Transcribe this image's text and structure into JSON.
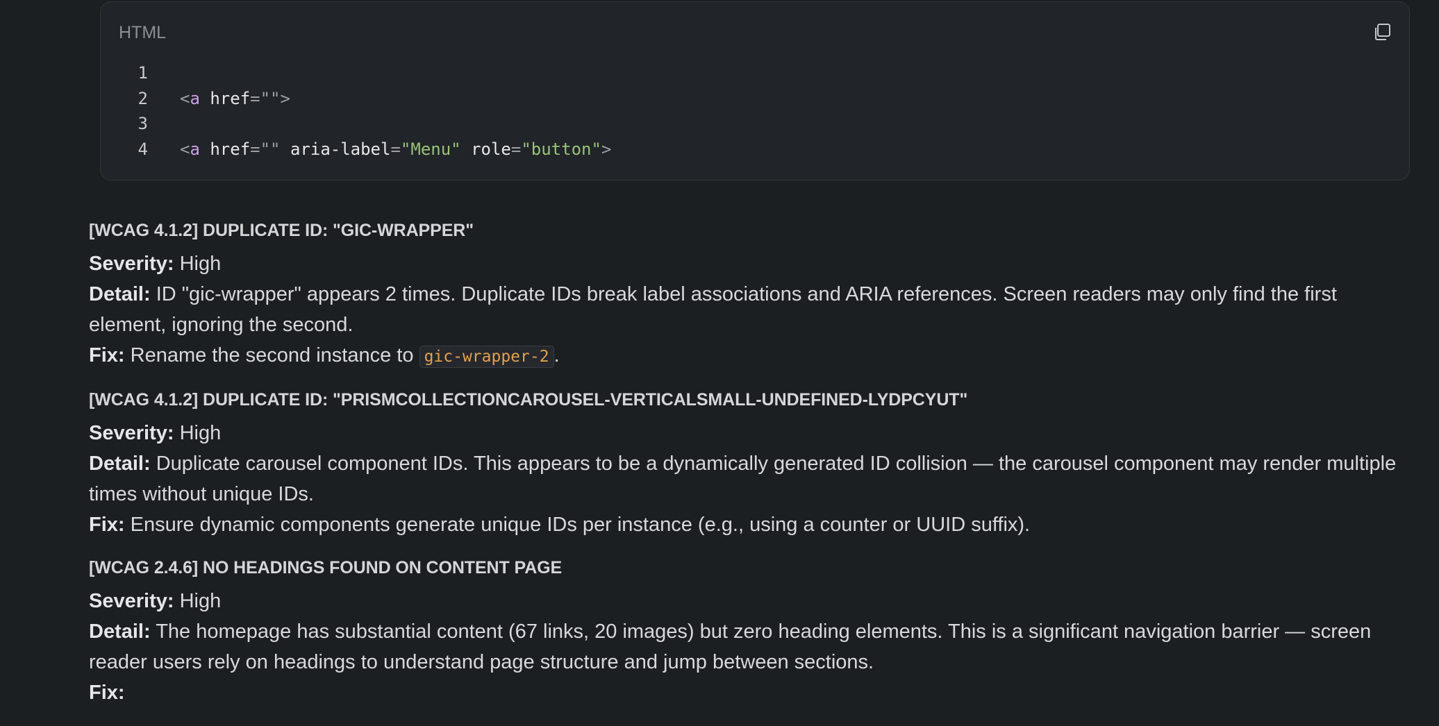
{
  "code_block": {
    "language": "HTML",
    "copy_icon": "copy-icon",
    "lines": [
      {
        "num": "1",
        "parts": []
      },
      {
        "num": "2",
        "parts": [
          {
            "t": "<",
            "k": "punc"
          },
          {
            "t": "a",
            "k": "tag"
          },
          {
            "t": " href",
            "k": "attr"
          },
          {
            "t": "=\"\"",
            "k": "punc"
          },
          {
            "t": ">",
            "k": "punc"
          }
        ]
      },
      {
        "num": "3",
        "parts": []
      },
      {
        "num": "4",
        "parts": [
          {
            "t": "<",
            "k": "punc"
          },
          {
            "t": "a",
            "k": "tag"
          },
          {
            "t": " href",
            "k": "attr"
          },
          {
            "t": "=\"\"",
            "k": "punc"
          },
          {
            "t": " aria-label",
            "k": "attr"
          },
          {
            "t": "=",
            "k": "punc"
          },
          {
            "t": "\"Menu\"",
            "k": "str"
          },
          {
            "t": " role",
            "k": "attr"
          },
          {
            "t": "=",
            "k": "punc"
          },
          {
            "t": "\"button\"",
            "k": "str"
          },
          {
            "t": ">",
            "k": "punc"
          }
        ]
      }
    ]
  },
  "issues": [
    {
      "title": "[WCAG 4.1.2] DUPLICATE ID: \"GIC-WRAPPER\"",
      "severity_label": "Severity:",
      "severity": "High",
      "detail_label": "Detail:",
      "detail": "ID \"gic-wrapper\" appears 2 times. Duplicate IDs break label associations and ARIA references. Screen readers may only find the first element, ignoring the second.",
      "fix_label": "Fix:",
      "fix_before": "Rename the second instance to ",
      "fix_code": "gic-wrapper-2",
      "fix_after": "."
    },
    {
      "title": "[WCAG 4.1.2] DUPLICATE ID: \"PRISMCOLLECTIONCAROUSEL-VERTICALSMALL-UNDEFINED-LYDPCYUT\"",
      "severity_label": "Severity:",
      "severity": "High",
      "detail_label": "Detail:",
      "detail": "Duplicate carousel component IDs. This appears to be a dynamically generated ID collision — the carousel component may render multiple times without unique IDs.",
      "fix_label": "Fix:",
      "fix_before": "Ensure dynamic components generate unique IDs per instance (e.g., using a counter or UUID suffix).",
      "fix_code": "",
      "fix_after": ""
    },
    {
      "title": "[WCAG 2.4.6] NO HEADINGS FOUND ON CONTENT PAGE",
      "severity_label": "Severity:",
      "severity": "High",
      "detail_label": "Detail:",
      "detail": "The homepage has substantial content (67 links, 20 images) but zero heading elements. This is a significant navigation barrier — screen reader users rely on headings to understand page structure and jump between sections.",
      "fix_label": "Fix:",
      "fix_before": "",
      "fix_code": "",
      "fix_after": ""
    }
  ]
}
